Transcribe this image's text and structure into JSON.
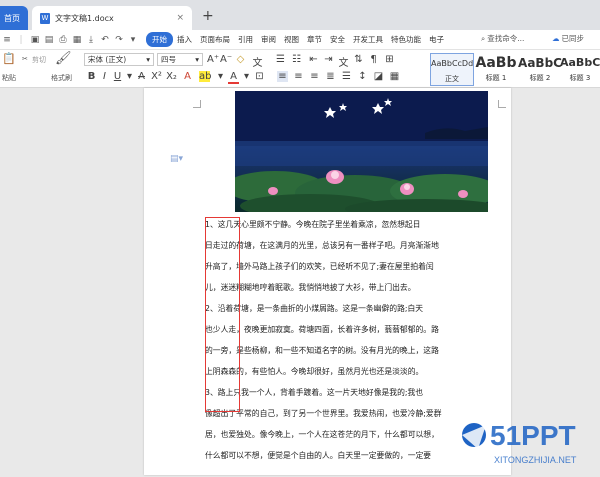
{
  "tabs": {
    "home": "首页",
    "document": "文字文稿1.docx",
    "close": "×",
    "add": "+"
  },
  "menu": {
    "items": [
      "开始",
      "插入",
      "页面布局",
      "引用",
      "审阅",
      "视图",
      "章节",
      "安全",
      "开发工具",
      "特色功能",
      "电子"
    ],
    "search": "查找命令...",
    "share": "已同步"
  },
  "ribbon": {
    "cut": "剪切",
    "paste": "粘贴",
    "format_painter": "格式刷",
    "font_name": "宋体 (正文)",
    "font_size": "四号",
    "styles": [
      {
        "sample": "AaBbCcDd",
        "label": "正文"
      },
      {
        "sample": "AaBb",
        "label": "标题 1"
      },
      {
        "sample": "AaBbC",
        "label": "标题 2"
      },
      {
        "sample": "AaBbC",
        "label": "标题 3"
      }
    ]
  },
  "document": {
    "lines": [
      "1、这几天心里颇不宁静。今晚在院子里坐着乘凉，忽然想起日",
      "日走过的荷塘，在这满月的光里，总该另有一番样子吧。月亮渐渐地",
      "升高了，墙外马路上孩子们的欢笑，已经听不见了;妻在屋里拍着闰",
      "儿，迷迷糊糊地哼着眠歌。我悄悄地披了大衫，带上门出去。",
      "2、沿着荷塘，是一条曲折的小煤屑路。这是一条幽僻的路;白天",
      "也少人走，夜晚更加寂寞。荷塘四面，长着许多树，蓊蓊郁郁的。路",
      "的一旁，是些杨柳，和一些不知道名字的树。没有月光的晚上，这路",
      "上阴森森的，有些怕人。今晚却很好，虽然月光也还是淡淡的。",
      "3、路上只我一个人，背着手踱着。这一片天地好像是我的;我也",
      "像超出了平常的自己，到了另一个世界里。我爱热闹，也爱冷静;爱群",
      "居，也爱独处。像今晚上，一个人在这苍茫的月下，什么都可以想，",
      "什么都可以不想，便觉是个自由的人。白天里一定要做的，一定要"
    ]
  },
  "watermark": {
    "brand": "51PPT",
    "url": "XITONGZHIJIA.NET"
  },
  "colors": {
    "accent": "#2f6fd6",
    "highlight_box": "#e53935"
  }
}
